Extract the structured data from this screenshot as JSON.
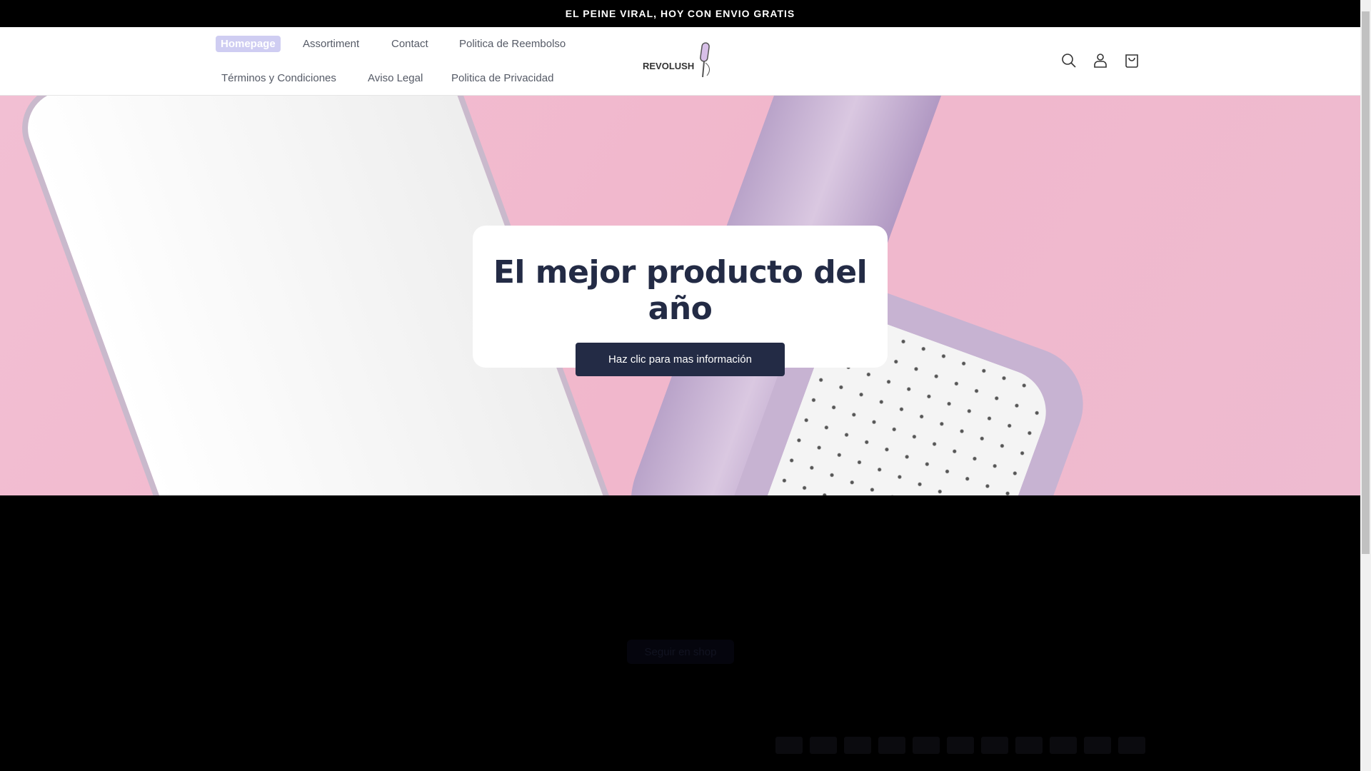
{
  "announcement": "EL PEINE VIRAL, HOY CON ENVIO GRATIS",
  "nav": [
    "Homepage",
    "Assortiment",
    "Contact",
    "Politica de Reembolso",
    "Términos y Condiciones",
    "Aviso Legal",
    "Politica de Privacidad"
  ],
  "logo": "REVOLUSH",
  "hero": {
    "title": "El mejor producto del año",
    "button": "Haz clic para mas información"
  },
  "footer": {
    "follow": "Seguir en shop",
    "payment_icons": [
      "amex",
      "apple-pay",
      "bancontact",
      "diners",
      "google-pay",
      "ideal",
      "maestro",
      "mastercard",
      "paypal",
      "shop-pay",
      "visa"
    ]
  }
}
